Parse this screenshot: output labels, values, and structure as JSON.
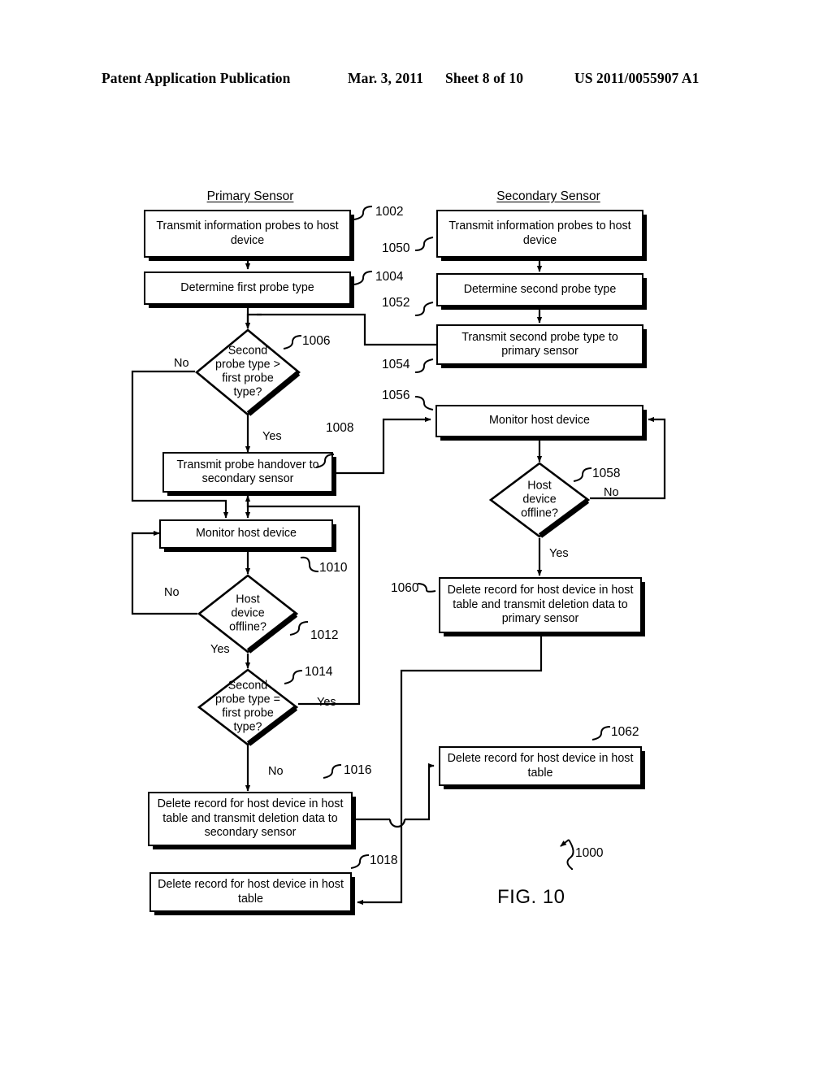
{
  "header": {
    "publication": "Patent Application Publication",
    "date": "Mar. 3, 2011",
    "sheet": "Sheet 8 of 10",
    "number": "US 2011/0055907 A1"
  },
  "figure": {
    "caption": "FIG. 10",
    "diagram_ref": "1000",
    "columns": {
      "primary": "Primary Sensor",
      "secondary": "Secondary Sensor"
    },
    "nodes": [
      {
        "id": "1002",
        "ref": "1002",
        "type": "process",
        "text": "Transmit information probes to host device"
      },
      {
        "id": "1004",
        "ref": "1004",
        "type": "process",
        "text": "Determine first probe type"
      },
      {
        "id": "1006",
        "ref": "1006",
        "type": "decision",
        "text": "Second\nprobe type >\nfirst probe\ntype?"
      },
      {
        "id": "1008",
        "ref": "1008",
        "type": "process",
        "text": "Transmit probe handover to secondary sensor"
      },
      {
        "id": "1010",
        "ref": "1010",
        "type": "process",
        "text": "Monitor host device"
      },
      {
        "id": "1012",
        "ref": "1012",
        "type": "decision",
        "text": "Host\ndevice\noffline?"
      },
      {
        "id": "1014",
        "ref": "1014",
        "type": "decision",
        "text": "Second\nprobe type =\nfirst probe\ntype?"
      },
      {
        "id": "1016",
        "ref": "1016",
        "type": "process",
        "text": "Delete record for host device in host table and transmit deletion data to secondary sensor"
      },
      {
        "id": "1018",
        "ref": "1018",
        "type": "process",
        "text": "Delete record for host device in host table"
      },
      {
        "id": "1050",
        "ref": "1050",
        "type": "process",
        "text": "Transmit information probes to host device"
      },
      {
        "id": "1052",
        "ref": "1052",
        "type": "process",
        "text": "Determine second probe type"
      },
      {
        "id": "1054",
        "ref": "1054",
        "type": "process",
        "text": "Transmit second probe type to primary sensor"
      },
      {
        "id": "1056",
        "ref": "1056",
        "type": "process",
        "text": "Monitor host device"
      },
      {
        "id": "1058",
        "ref": "1058",
        "type": "decision",
        "text": "Host\ndevice\noffline?"
      },
      {
        "id": "1060",
        "ref": "1060",
        "type": "process",
        "text": "Delete record for host device in host table and transmit deletion data to primary sensor"
      },
      {
        "id": "1062",
        "ref": "1062",
        "type": "process",
        "text": "Delete record for host device in host table"
      }
    ],
    "branch_labels": {
      "d1006_no": "No",
      "d1006_yes": "Yes",
      "d1012_no": "No",
      "d1012_yes": "Yes",
      "d1014_yes": "Yes",
      "d1014_no": "No",
      "d1058_no": "No",
      "d1058_yes": "Yes"
    }
  }
}
